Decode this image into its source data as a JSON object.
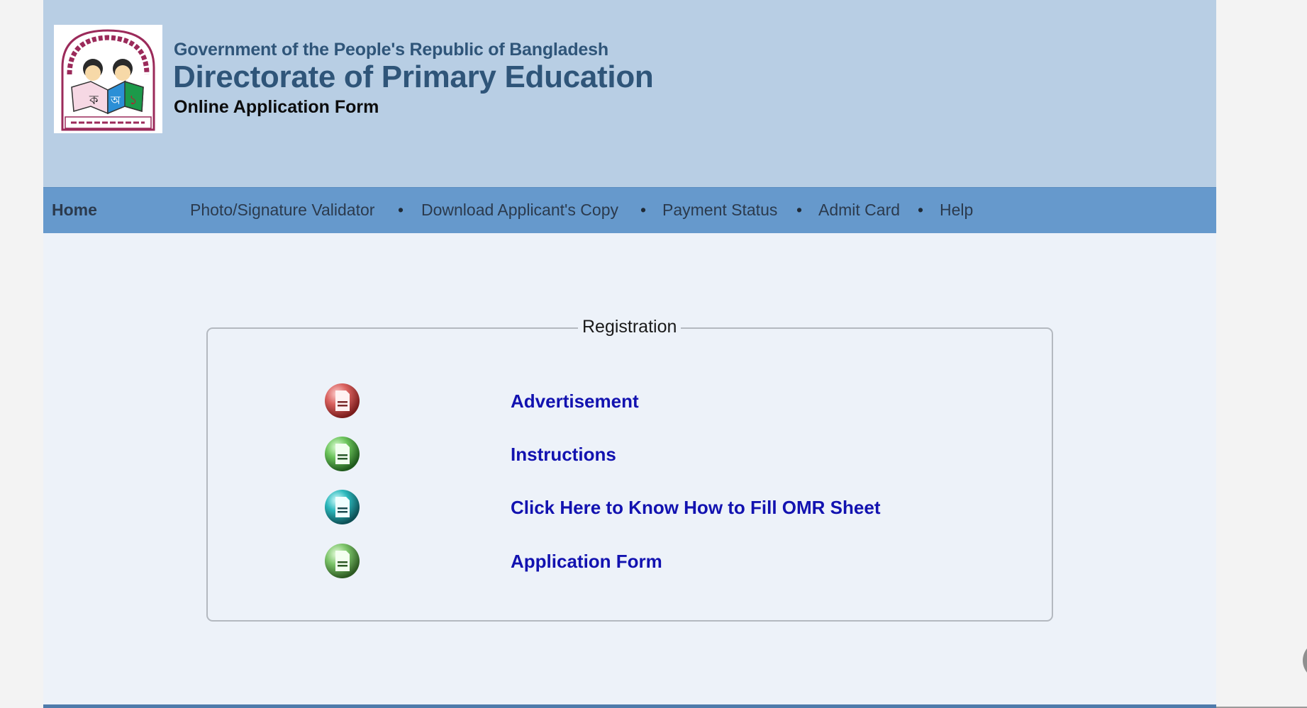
{
  "header": {
    "logo_alt": "Directorate of Primary Education logo",
    "government": "Government of the People's Republic of Bangladesh",
    "title": "Directorate of Primary Education",
    "subtitle": "Online Application Form"
  },
  "nav": {
    "home": "Home",
    "items": [
      {
        "label": "Photo/Signature Validator"
      },
      {
        "label": "Download Applicant's Copy"
      },
      {
        "label": "Payment Status"
      },
      {
        "label": "Admit Card"
      },
      {
        "label": "Help"
      }
    ],
    "separator": "•"
  },
  "registration": {
    "legend": "Registration",
    "items": [
      {
        "label": "Advertisement",
        "icon": "document-icon-red",
        "color": "#c84a4a"
      },
      {
        "label": "Instructions",
        "icon": "document-icon-green",
        "color": "#4caf50"
      },
      {
        "label": "Click Here to Know How to Fill OMR Sheet",
        "icon": "document-icon-teal",
        "color": "#1fa3a8"
      },
      {
        "label": "Application Form",
        "icon": "document-icon-green",
        "color": "#5cae4e"
      }
    ]
  },
  "colors": {
    "header_bg": "#b8cee4",
    "nav_bg": "#6699cc",
    "title_color": "#2f5579",
    "link_color": "#1212b0"
  }
}
